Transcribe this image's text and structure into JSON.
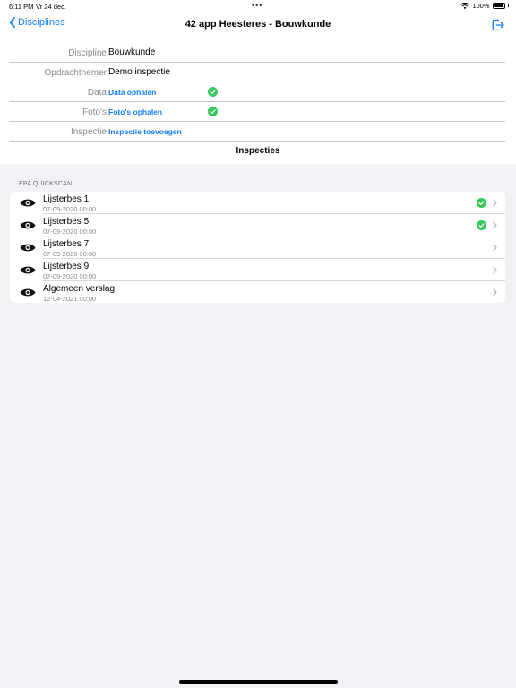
{
  "status_bar": {
    "time": "6:11 PM",
    "date": "Vr 24 dec.",
    "dots": "•••",
    "battery": "100%"
  },
  "navbar": {
    "back_label": "Disciplines",
    "title": "42 app Heesteres - Bouwkunde"
  },
  "form": {
    "discipline_label": "Discipline",
    "discipline_value": "Bouwkunde",
    "opdrachtnemer_label": "Opdrachtnemer",
    "opdrachtnemer_value": "Demo inspectie",
    "data_label": "Data",
    "data_link": "Data ophalen",
    "fotos_label": "Foto's",
    "fotos_link": "Foto's ophalen",
    "inspectie_label": "Inspectie",
    "inspectie_link": "Inspectie toevoegen",
    "inspecties_header": "Inspecties"
  },
  "list": {
    "section_title": "EPA QUICKSCAN",
    "items": [
      {
        "title": "Lijsterbes 1",
        "date": "07-09-2020 00:00",
        "done": true
      },
      {
        "title": "Lijsterbes 5",
        "date": "07-09-2020 00:00",
        "done": true
      },
      {
        "title": "Lijsterbes 7",
        "date": "07-09-2020 00:00",
        "done": false
      },
      {
        "title": "Lijsterbes 9",
        "date": "07-09-2020 00:00",
        "done": false
      },
      {
        "title": "Algemeen verslag",
        "date": "12-04-2021 00:00",
        "done": false
      }
    ]
  },
  "colors": {
    "accent": "#147efb",
    "success": "#34c759",
    "background": "#f1f1f6"
  },
  "icons": [
    "chevron-left-icon",
    "exit-icon",
    "wifi-icon",
    "battery-icon",
    "check-circle-icon",
    "eye-icon",
    "chevron-right-icon"
  ]
}
